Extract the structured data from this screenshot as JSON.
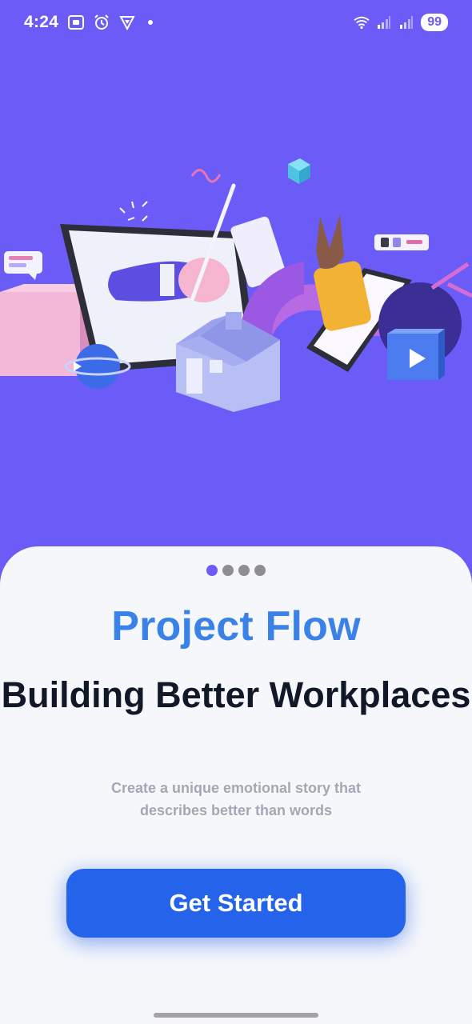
{
  "status_bar": {
    "time": "4:24",
    "battery": "99",
    "icons": [
      "screenshot-icon",
      "alarm-icon",
      "vpn-icon",
      "wifi-icon",
      "signal-icon",
      "signal-icon-2"
    ]
  },
  "onboarding": {
    "page_indicator": {
      "total": 4,
      "active": 1
    },
    "brand": "Project Flow",
    "headline": "Building Better Workplaces",
    "subtitle": "Create a unique emotional story that describes better than words",
    "cta_label": "Get Started"
  },
  "colors": {
    "hero_background": "#6C5CF7",
    "brand_text": "#3B82E8",
    "cta_background": "#2563EB",
    "headline_text": "#111827",
    "subtitle_text": "#A3A8B4"
  }
}
